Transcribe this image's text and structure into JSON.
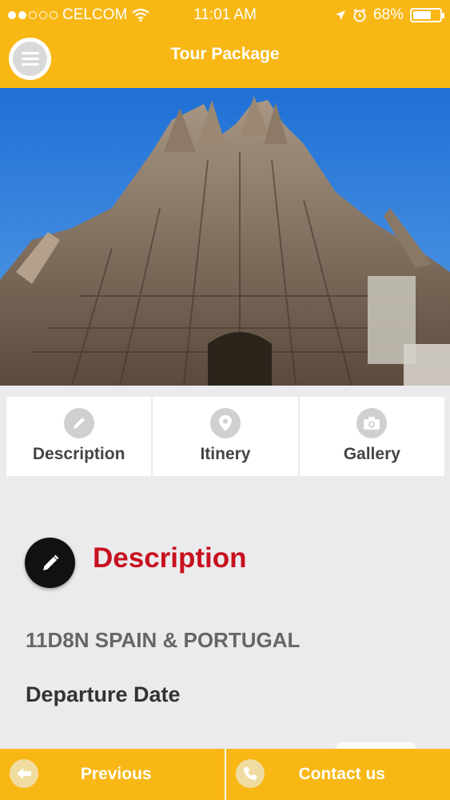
{
  "status": {
    "carrier": "CELCOM",
    "time": "11:01 AM",
    "battery": "68%",
    "battery_level": 0.68
  },
  "header": {
    "title": "Tour Package"
  },
  "tabs": [
    {
      "label": "Description",
      "icon": "pencil-icon"
    },
    {
      "label": "Itinery",
      "icon": "map-pin-icon"
    },
    {
      "label": "Gallery",
      "icon": "camera-icon"
    }
  ],
  "section": {
    "title": "Description",
    "icon": "pencil-icon",
    "title_color": "#c8101f"
  },
  "package": {
    "name": "11D8N SPAIN & PORTUGAL"
  },
  "departure": {
    "label": "Departure Date"
  },
  "footer": {
    "prev_label": "Previous",
    "contact_label": "Contact us"
  },
  "colors": {
    "accent": "#f8b714"
  }
}
